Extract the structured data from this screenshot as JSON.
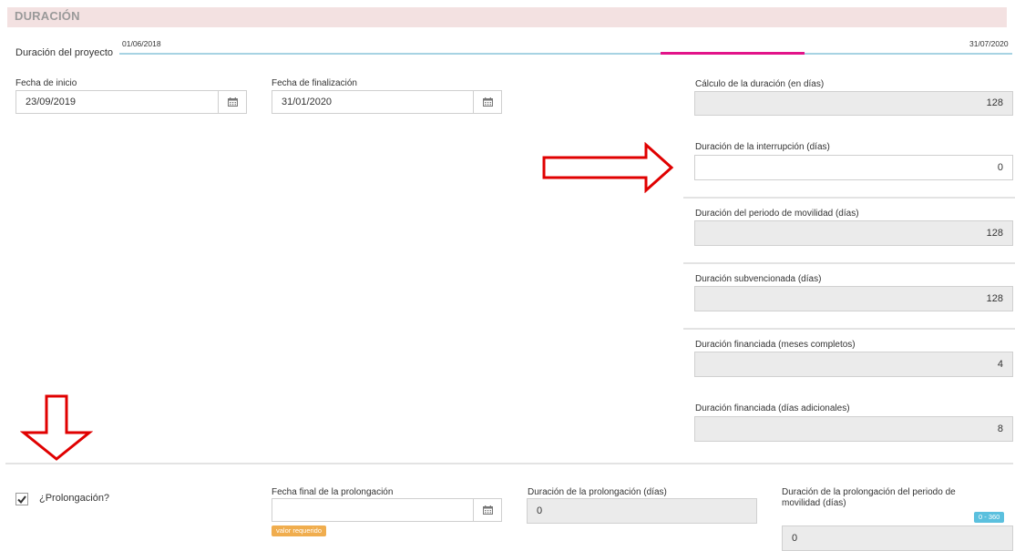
{
  "section": {
    "title": "DURACIÓN"
  },
  "timeline": {
    "label": "Duración del proyecto",
    "start_date": "01/06/2018",
    "end_date": "31/07/2020"
  },
  "start_date": {
    "label": "Fecha de inicio",
    "value": "23/09/2019"
  },
  "end_date": {
    "label": "Fecha de finalización",
    "value": "31/01/2020"
  },
  "duration_calc": {
    "label": "Cálculo de la duración (en días)",
    "value": "128"
  },
  "interruption": {
    "label": "Duración de la interrupción (días)",
    "value": "0"
  },
  "mobility_duration": {
    "label": "Duración del periodo de movilidad (días)",
    "value": "128"
  },
  "subsidized_duration": {
    "label": "Duración subvencionada (días)",
    "value": "128"
  },
  "financed_months": {
    "label": "Duración financiada (meses completos)",
    "value": "4"
  },
  "financed_extra_days": {
    "label": "Duración financiada (días adicionales)",
    "value": "8"
  },
  "extension": {
    "checkbox_label": "¿Prolongación?",
    "checked": true,
    "end_date_label": "Fecha final de la prolongación",
    "end_date_value": "",
    "required_badge": "valor requerido",
    "duration_label": "Duración de la prolongación (días)",
    "duration_value": "0",
    "mobility_label": "Duración de la prolongación del periodo de movilidad (días)",
    "mobility_range": "0 - 360",
    "mobility_value": "0"
  },
  "colors": {
    "header_bg": "#f3e1e1",
    "timeline": "#a7d3e3",
    "timeline_progress": "#e21389",
    "arrow": "#e00000",
    "required": "#f0ad4e",
    "range": "#5bc0de"
  },
  "icons": [
    "calendar-icon",
    "checkmark-icon",
    "red-arrow-right-icon",
    "red-arrow-down-icon"
  ]
}
